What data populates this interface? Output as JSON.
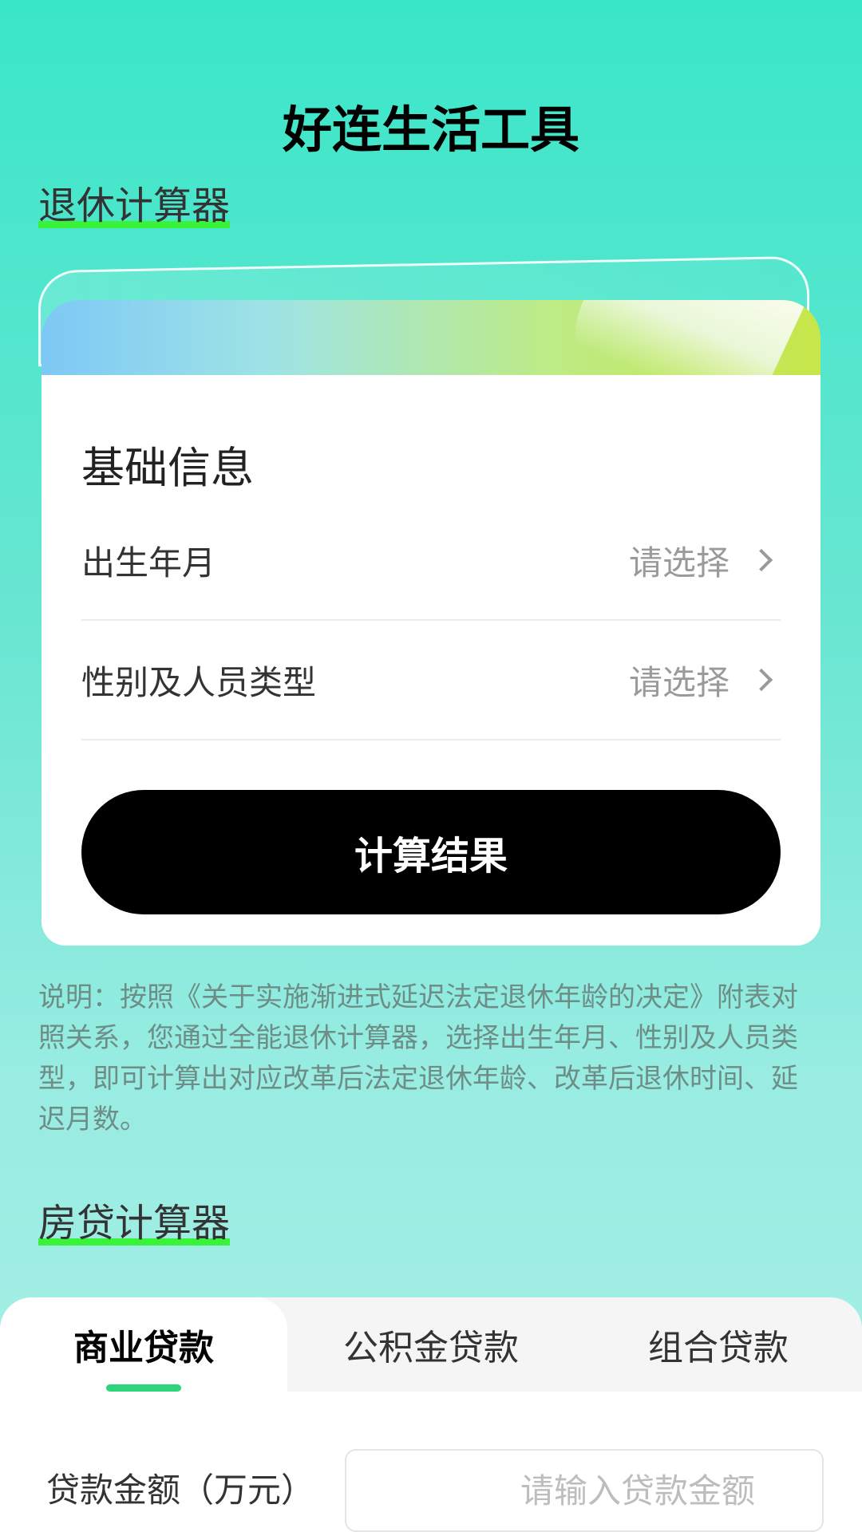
{
  "header": {
    "title": "好连生活工具"
  },
  "retirement": {
    "section_title": "退休计算器",
    "card_title": "基础信息",
    "fields": [
      {
        "label": "出生年月",
        "value": "请选择"
      },
      {
        "label": "性别及人员类型",
        "value": "请选择"
      }
    ],
    "calc_button": "计算结果",
    "note": "说明：按照《关于实施渐进式延迟法定退休年龄的决定》附表对照关系，您通过全能退休计算器，选择出生年月、性别及人员类型，即可计算出对应改革后法定退休年龄、改革后退休时间、延迟月数。"
  },
  "mortgage": {
    "section_title": "房贷计算器",
    "tabs": [
      {
        "label": "商业贷款",
        "active": true
      },
      {
        "label": "公积金贷款",
        "active": false
      },
      {
        "label": "组合贷款",
        "active": false
      }
    ],
    "amount_label": "贷款金额（万元）",
    "amount_placeholder": "请输入贷款金额",
    "amount_value": ""
  },
  "colors": {
    "accent_green": "#39f23a",
    "tab_indicator": "#2fd57d",
    "button_bg": "#000000"
  },
  "icons": [
    "chevron-right-icon",
    "chevron-right-icon"
  ]
}
